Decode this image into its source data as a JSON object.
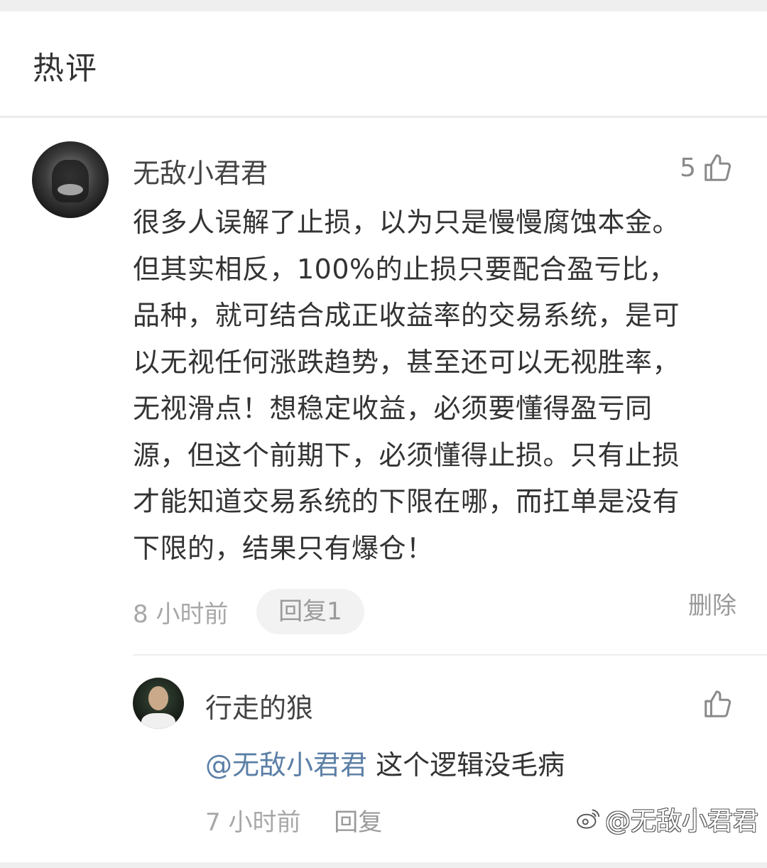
{
  "section": {
    "title": "热评"
  },
  "comment": {
    "username": "无敌小君君",
    "like_count": "5",
    "body_lines": [
      "很多人误解了止损，以为只是慢慢腐蚀本金。",
      "但其实相反，100%的止损只要配合盈亏比，",
      "品种，就可结合成正收益率的交易系统，是可",
      "以无视任何涨跌趋势，甚至还可以无视胜率，",
      "无视滑点！想稳定收益，必须要懂得盈亏同",
      "源，但这个前期下，必须懂得止损。只有止损",
      "才能知道交易系统的下限在哪，而扛单是没有",
      "下限的，结果只有爆仓！"
    ],
    "time": "8 小时前",
    "reply_button": "回复1",
    "delete_label": "删除"
  },
  "reply": {
    "username": "行走的狼",
    "mention": "@无敌小君君",
    "text": " 这个逻辑没毛病",
    "time": "7 小时前",
    "reply_label": "回复"
  },
  "watermark": {
    "text": "@无敌小君君"
  },
  "icons": {
    "like": "thumbs-up-icon",
    "avatar_main": "avatar",
    "avatar_reply": "avatar",
    "watermark_logo": "weibo-logo-icon"
  },
  "colors": {
    "mention": "#5b7fa6",
    "muted_text": "#a8a8a8",
    "pill_background": "#f2f2f2",
    "divider": "#eeeeee"
  }
}
